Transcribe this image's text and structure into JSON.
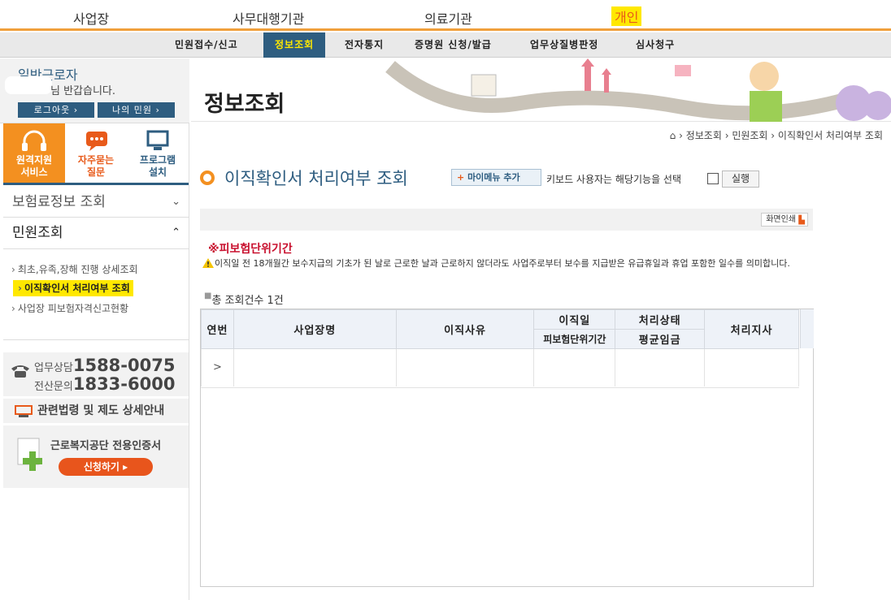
{
  "topnav": {
    "items": [
      "사업장",
      "사무대행기관",
      "의료기관",
      "개인"
    ]
  },
  "subnav": {
    "items": [
      "민원접수/신고",
      "정보조회",
      "전자통지",
      "증명원 신청/발급",
      "업무상질병판정",
      "심사청구"
    ]
  },
  "user": {
    "role": "일반근로자",
    "greeting": "님 반갑습니다.",
    "logout": "로그아웃",
    "mypage": "나의 민원"
  },
  "quick": {
    "remote": "원격지원\n서비스",
    "faq": "자주묻는\n질문",
    "install": "프로그램\n설치"
  },
  "leftmenu": {
    "m1": "보험료정보 조회",
    "m2": "민원조회",
    "subs": [
      "최초,유족,장해 진행 상세조회",
      "이직확인서 처리여부 조회",
      "사업장 피보험자격신고현황"
    ]
  },
  "contact": {
    "label1": "업무상담",
    "num1": "1588-0075",
    "label2": "전산문의",
    "num2": "1833-6000"
  },
  "law": "관련법령 및 제도 상세안내",
  "cert": {
    "title": "근로복지공단 전용인증서",
    "button": "신청하기"
  },
  "banner": {
    "title": "정보조회"
  },
  "breadcrumb": {
    "items": [
      "정보조회",
      "민원조회",
      "이직확인서 처리여부 조회"
    ]
  },
  "page": {
    "title": "이직확인서 처리여부 조회",
    "mymenu": "마이메뉴 추가",
    "kbd": "키보드 사용자는 해당기능을 선택",
    "run": "실행",
    "print": "화면인쇄"
  },
  "note": {
    "head": "※피보험단위기간",
    "text": "이직일 전 18개월간 보수지급의 기초가 된 날로 근로한 날과 근로하지 않더라도 사업주로부터 보수를 지급받은 유급휴일과 휴업 포함한 일수를 의미합니다."
  },
  "count": "총 조회건수 1건",
  "table": {
    "h_no": "연번",
    "h_biz": "사업장명",
    "h_reason": "이직사유",
    "h_date": "이직일",
    "h_period": "피보험단위기간",
    "h_status": "처리상태",
    "h_wage": "평균임금",
    "h_branch": "처리지사",
    "row_toggle": ">"
  },
  "colors": {
    "accent": "#f39020",
    "navy": "#2e5d80",
    "highlight": "#ffe800",
    "red": "#c8102e"
  }
}
